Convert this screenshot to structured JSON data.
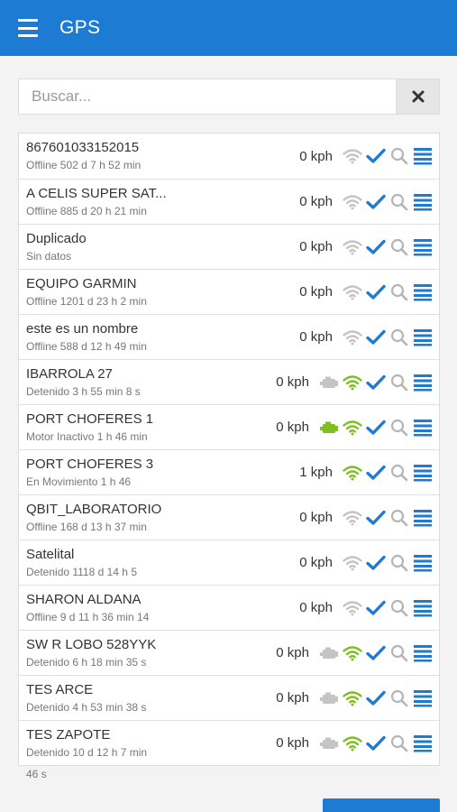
{
  "header": {
    "title": "GPS"
  },
  "search": {
    "placeholder": "Buscar..."
  },
  "colors": {
    "primary": "#1e7bd3",
    "green": "#7cbf1e",
    "grey": "#c4c4c4",
    "check": "#1e7bd3",
    "list_icon": "#1e7bd3"
  },
  "devices": [
    {
      "name": "867601033152015",
      "status": "Offline 502 d 7 h 52 min",
      "speed": "0 kph",
      "engine": null,
      "wifi": "grey"
    },
    {
      "name": "A CELIS SUPER SAT...",
      "status": "Offline 885 d 20 h 21 min",
      "speed": "0 kph",
      "engine": null,
      "wifi": "grey"
    },
    {
      "name": "Duplicado",
      "status": "Sin datos",
      "speed": "0 kph",
      "engine": null,
      "wifi": "grey"
    },
    {
      "name": "EQUIPO GARMIN",
      "status": "Offline 1201 d 23 h 2 min",
      "speed": "0 kph",
      "engine": null,
      "wifi": "grey"
    },
    {
      "name": "este es un nombre",
      "status": "Offline 588 d 12 h 49 min",
      "speed": "0 kph",
      "engine": null,
      "wifi": "grey"
    },
    {
      "name": "IBARROLA 27",
      "status": "Detenido 3 h 55 min 8 s",
      "speed": "0 kph",
      "engine": "grey",
      "wifi": "green"
    },
    {
      "name": "PORT CHOFERES 1",
      "status": "Motor Inactivo 1 h 46 min",
      "speed": "0 kph",
      "engine": "green",
      "wifi": "green"
    },
    {
      "name": "PORT CHOFERES 3",
      "status": "En Movimiento 1 h 46",
      "speed": "1 kph",
      "engine": null,
      "wifi": "green"
    },
    {
      "name": "QBIT_LABORATORIO",
      "status": "Offline 168 d 13 h 37 min",
      "speed": "0 kph",
      "engine": null,
      "wifi": "grey"
    },
    {
      "name": "Satelital",
      "status": "Detenido 1118 d 14 h 5",
      "speed": "0 kph",
      "engine": null,
      "wifi": "grey"
    },
    {
      "name": "SHARON ALDANA",
      "status": "Offline 9 d 11 h 36 min 14",
      "speed": "0 kph",
      "engine": null,
      "wifi": "grey"
    },
    {
      "name": "SW R LOBO 528YYK",
      "status": "Detenido 6 h 18 min 35 s",
      "speed": "0 kph",
      "engine": "grey",
      "wifi": "green"
    },
    {
      "name": "TES ARCE",
      "status": "Detenido 4 h 53 min 38 s",
      "speed": "0 kph",
      "engine": "grey",
      "wifi": "green"
    },
    {
      "name": "TES ZAPOTE",
      "status": "Detenido 10 d 12 h 7 min",
      "status2": "46 s",
      "speed": "0 kph",
      "engine": "grey",
      "wifi": "green"
    }
  ]
}
